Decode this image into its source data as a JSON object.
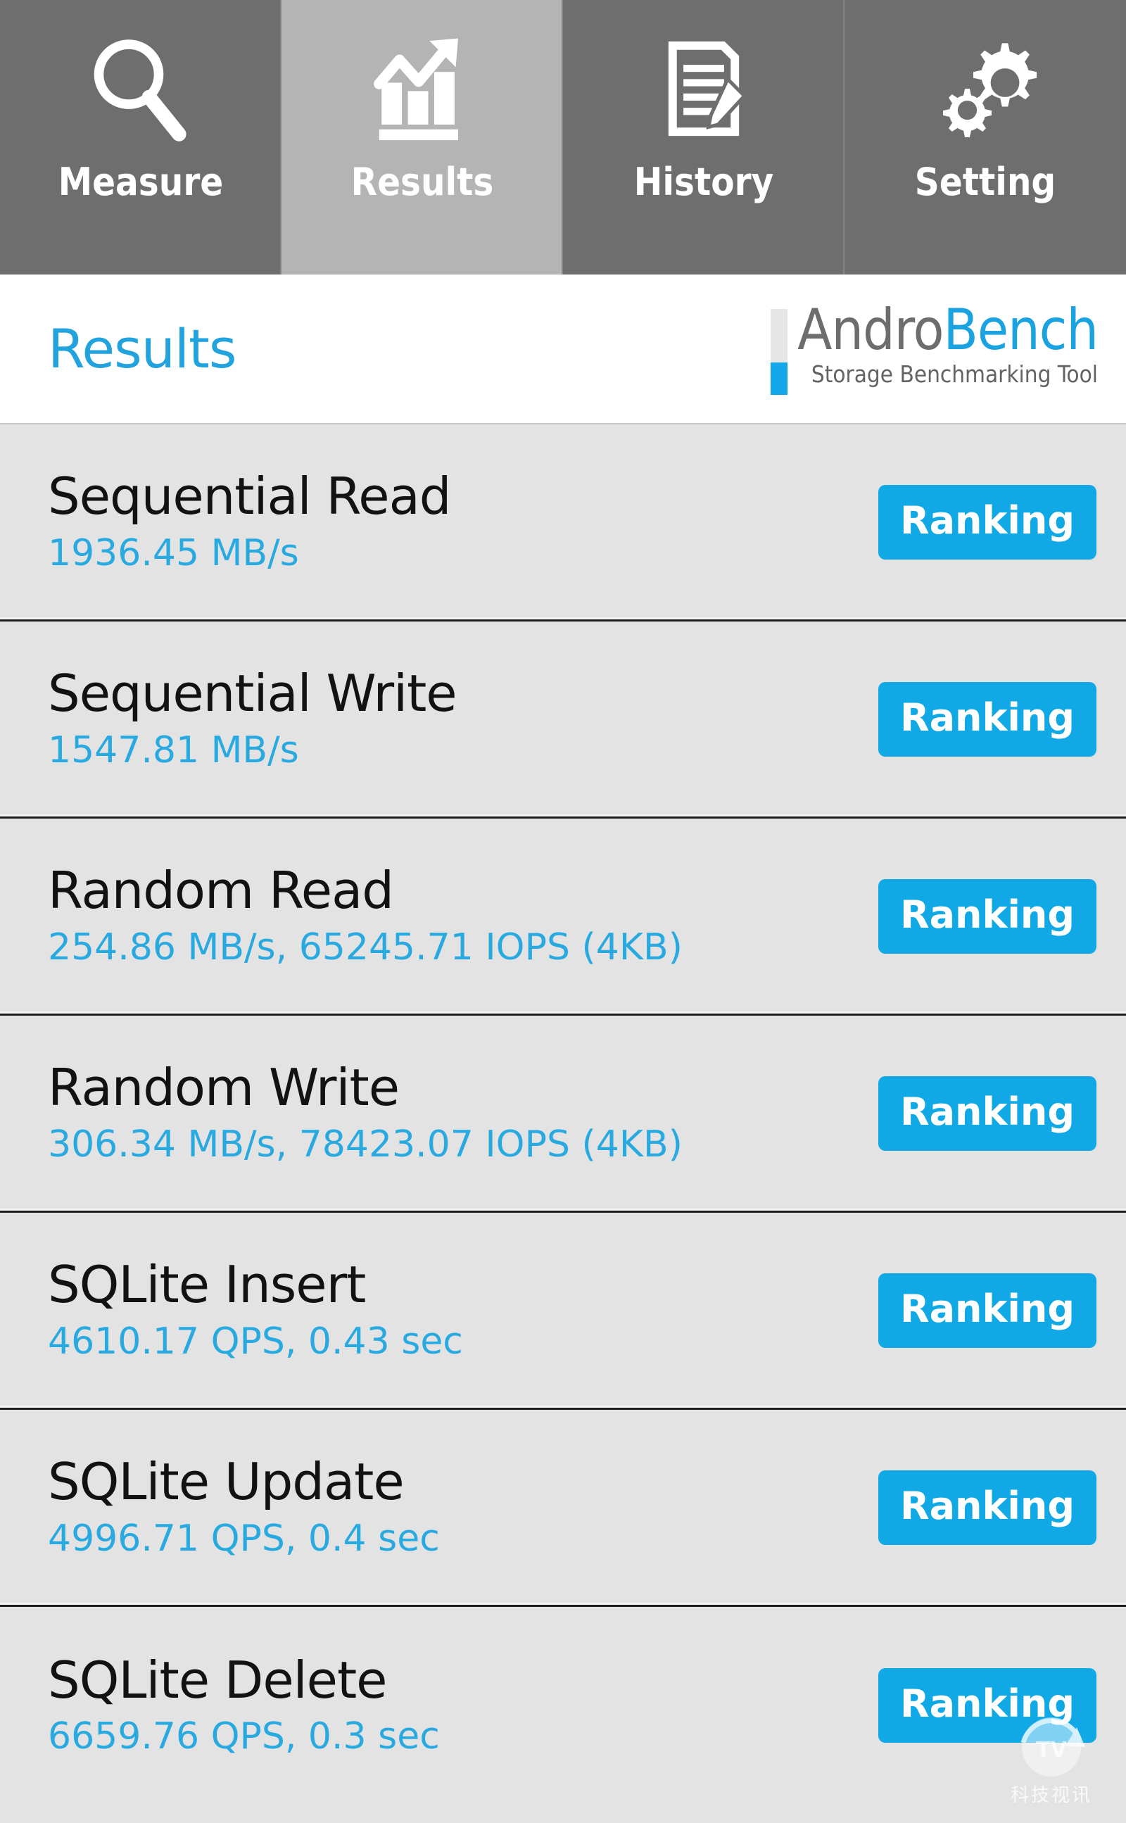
{
  "tabs": [
    {
      "label": "Measure",
      "icon": "magnifier-icon",
      "active": false
    },
    {
      "label": "Results",
      "icon": "bar-chart-arrow-icon",
      "active": true
    },
    {
      "label": "History",
      "icon": "document-pencil-icon",
      "active": false
    },
    {
      "label": "Setting",
      "icon": "gears-icon",
      "active": false
    }
  ],
  "header": {
    "page_title": "Results",
    "logo_part1": "Andro",
    "logo_part2": "Bench",
    "logo_subtitle": "Storage Benchmarking Tool"
  },
  "colors": {
    "accent_blue": "#11a8e6",
    "value_blue": "#28a9e0",
    "title_blue": "#22a3dd",
    "logo_gray": "#6d6d6d",
    "tab_inactive": "#6e6e6e",
    "tab_active": "#b4b4b4",
    "row_bg": "#e3e3e3"
  },
  "results": [
    {
      "name": "Sequential Read",
      "value": "1936.45 MB/s",
      "button": "Ranking"
    },
    {
      "name": "Sequential Write",
      "value": "1547.81 MB/s",
      "button": "Ranking"
    },
    {
      "name": "Random Read",
      "value": "254.86 MB/s, 65245.71 IOPS (4KB)",
      "button": "Ranking"
    },
    {
      "name": "Random Write",
      "value": "306.34 MB/s, 78423.07 IOPS (4KB)",
      "button": "Ranking"
    },
    {
      "name": "SQLite Insert",
      "value": "4610.17 QPS, 0.43 sec",
      "button": "Ranking"
    },
    {
      "name": "SQLite Update",
      "value": "4996.71 QPS, 0.4 sec",
      "button": "Ranking"
    },
    {
      "name": "SQLite Delete",
      "value": "6659.76 QPS, 0.3 sec",
      "button": "Ranking"
    }
  ],
  "watermark": {
    "logo_letters": "TV",
    "caption": "科技视讯"
  }
}
